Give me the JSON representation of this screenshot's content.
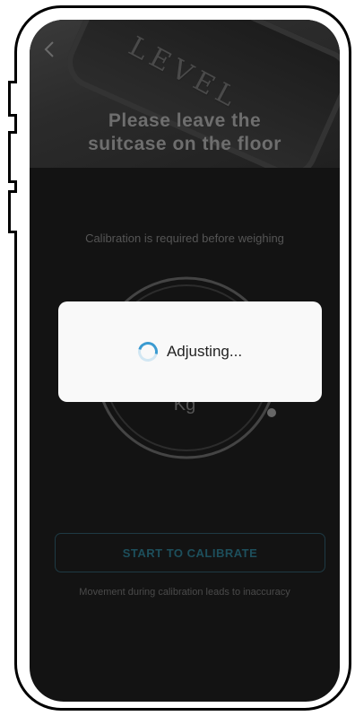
{
  "hero": {
    "brand": "LEVEL",
    "title_line1": "Please leave the",
    "title_line2": "suitcase on the floor"
  },
  "nav": {
    "back_icon": "chevron-left-icon"
  },
  "calibration": {
    "note": "Calibration is required before  weighing",
    "unit": "Kg",
    "button_label": "START TO CALIBRATE",
    "warning": "Movement during calibration leads to inaccuracy"
  },
  "modal": {
    "text": "Adjusting...",
    "spinner_icon": "loading-spinner-icon"
  },
  "colors": {
    "screen_bg": "#131313",
    "accent": "#3b9bd1",
    "button_text": "#1d4f5c",
    "modal_bg": "#f9f9f9"
  }
}
